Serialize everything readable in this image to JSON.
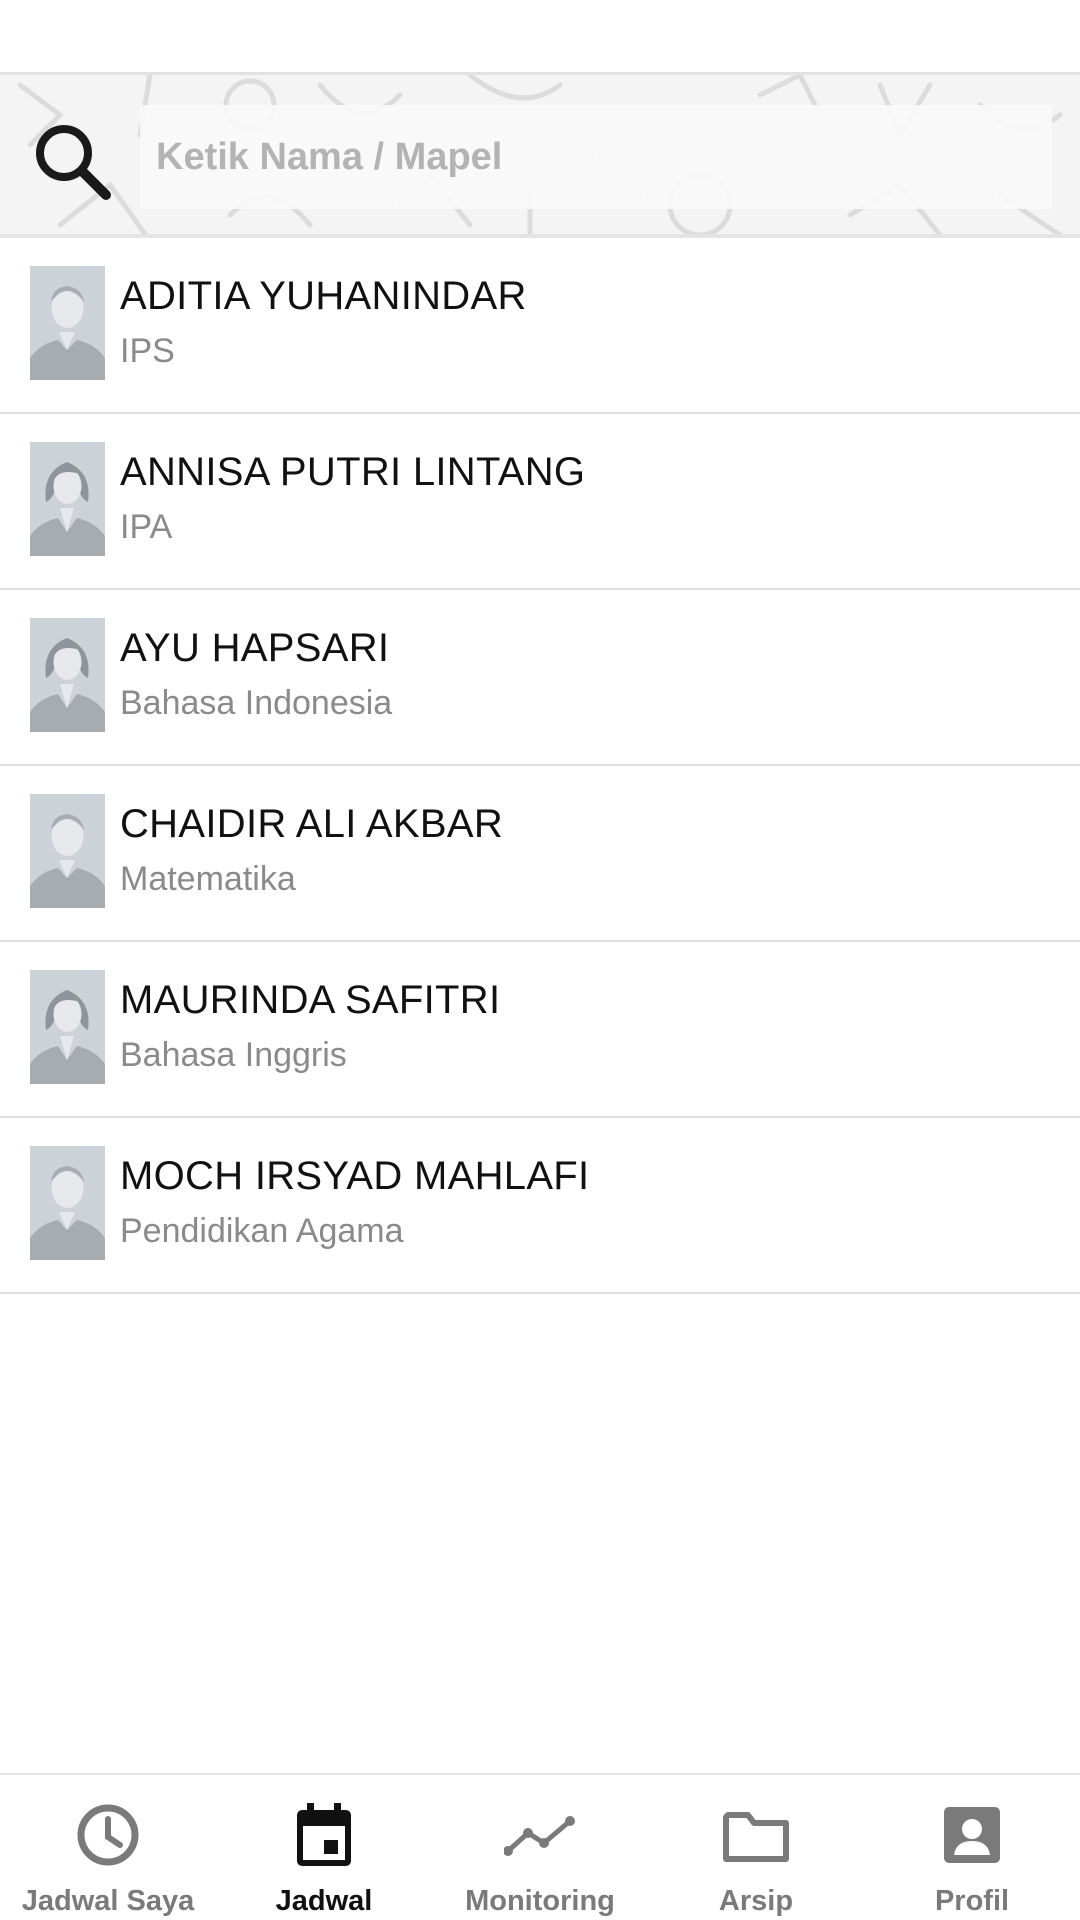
{
  "search": {
    "placeholder": "Ketik Nama / Mapel",
    "value": ""
  },
  "teachers": [
    {
      "name": "ADITIA YUHANINDAR",
      "subject": "IPS",
      "avatar": "male-avatar"
    },
    {
      "name": "ANNISA PUTRI LINTANG",
      "subject": "IPA",
      "avatar": "female-avatar"
    },
    {
      "name": "AYU HAPSARI",
      "subject": "Bahasa Indonesia",
      "avatar": "female-avatar"
    },
    {
      "name": "CHAIDIR ALI AKBAR",
      "subject": "Matematika",
      "avatar": "male-avatar"
    },
    {
      "name": "MAURINDA SAFITRI",
      "subject": "Bahasa Inggris",
      "avatar": "female-avatar"
    },
    {
      "name": "MOCH IRSYAD MAHLAFI",
      "subject": "Pendidikan Agama",
      "avatar": "male-avatar"
    }
  ],
  "nav": {
    "items": [
      {
        "label": "Jadwal Saya",
        "icon": "clock-icon",
        "active": false
      },
      {
        "label": "Jadwal",
        "icon": "calendar-icon",
        "active": true
      },
      {
        "label": "Monitoring",
        "icon": "trend-line-icon",
        "active": false
      },
      {
        "label": "Arsip",
        "icon": "folder-icon",
        "active": false
      },
      {
        "label": "Profil",
        "icon": "account-box-icon",
        "active": false
      }
    ]
  },
  "colors": {
    "active_nav": "#111111",
    "inactive_nav": "#7a7a7a",
    "subject_text": "#8a8a8a",
    "divider": "#dedede"
  }
}
